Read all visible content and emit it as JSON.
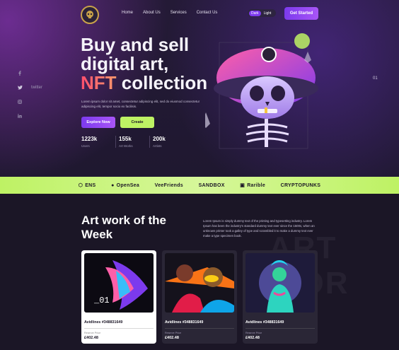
{
  "nav": {
    "items": [
      "Home",
      "About Us",
      "Services",
      "Contact Us"
    ]
  },
  "theme_toggle": {
    "dark": "Dark",
    "light": "Light"
  },
  "header": {
    "cta": "Get Started"
  },
  "social": [
    {
      "icon": "facebook-icon",
      "label": ""
    },
    {
      "icon": "twitter-icon",
      "label": "twitter"
    },
    {
      "icon": "instagram-icon",
      "label": ""
    },
    {
      "icon": "linkedin-icon",
      "label": ""
    }
  ],
  "hero": {
    "title_line1": "Buy and sell",
    "title_line2": "digital art,",
    "title_nft": "NFT",
    "title_line3": " collection",
    "description": "Lorem ipsum dolor sit amet, consectetur adipiscing elit, sed do eiusmod consectetur adipiscing elit, tempor socio ex facilisis.",
    "explore_label": "Explore Now",
    "create_label": "Create",
    "slide_number": "01",
    "stats": [
      {
        "value": "1223k",
        "label": "Users"
      },
      {
        "value": "155k",
        "label": "Art Works"
      },
      {
        "value": "200k",
        "label": "Artists"
      }
    ]
  },
  "partners": [
    "ENS",
    "OpenSea",
    "VeeFriends",
    "SANDBOX",
    "Rarible",
    "CRYPTOPUNKS"
  ],
  "artwork_section": {
    "title": "Art work of the Week",
    "blurb": "Lorem Ipsum is simply dummy text of the printing and typesetting industry. Lorem Ipsum has been the industry's standard dummy text ever since the 1500s, when an unknown printer took a galley of type and scrambled it to make a dummy text ever make a type specimen book.",
    "watermark": "ART WOR",
    "cards": [
      {
        "title": "Avidlines #348831649",
        "price_label": "Reserve Price",
        "price": "£402.48",
        "art_text": "_01"
      },
      {
        "title": "Avidlines #348831649",
        "price_label": "Reserve Price",
        "price": "£402.48"
      },
      {
        "title": "Avidlines #348831649",
        "price_label": "Reserve Price",
        "price": "£402.48"
      }
    ]
  },
  "colors": {
    "accent": "#7c3aed",
    "lime": "#bef264",
    "background": "#1b1626"
  }
}
